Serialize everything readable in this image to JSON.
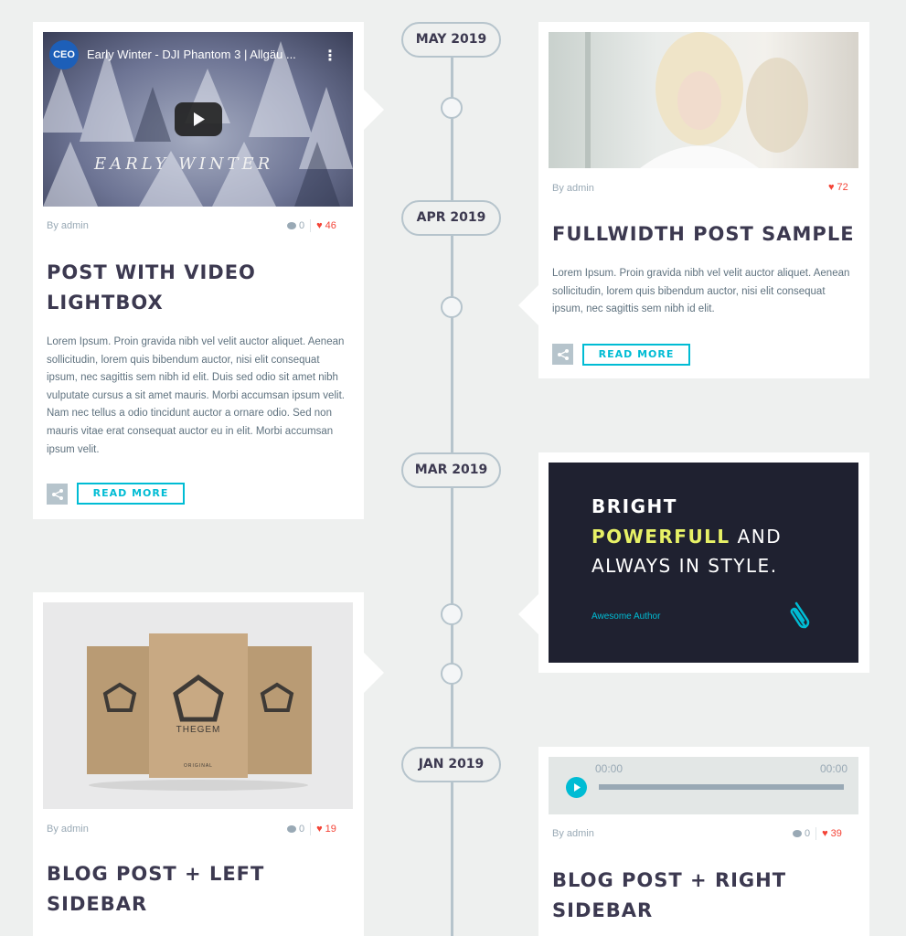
{
  "timeline": {
    "dates": [
      "MAY 2019",
      "APR 2019",
      "MAR 2019",
      "JAN 2019"
    ]
  },
  "posts": [
    {
      "author": "By admin",
      "comments": "0",
      "likes": "46",
      "title": "POST WITH VIDEO LIGHTBOX",
      "excerpt": "Lorem Ipsum. Proin gravida nibh vel velit auctor aliquet. Aenean sollicitudin, lorem quis bibendum auctor, nisi elit consequat ipsum, nec sagittis sem nibh id elit. Duis sed odio sit amet nibh vulputate cursus a sit amet mauris. Morbi accumsan ipsum velit. Nam nec tellus a odio tincidunt auctor a ornare odio. Sed non mauris vitae erat consequat auctor eu in elit. Morbi accumsan ipsum velit.",
      "read_more": "READ MORE",
      "video": {
        "channel_logo": "CEO",
        "title": "Early Winter - DJI Phantom 3 | Allgäu ...",
        "overlay_text": "EARLY WINTER"
      }
    },
    {
      "author": "By admin",
      "likes": "72",
      "title": "FULLWIDTH POST SAMPLE",
      "excerpt": "Lorem Ipsum. Proin gravida nibh vel velit auctor aliquet. Aenean sollicitudin, lorem quis bibendum auctor, nisi elit consequat ipsum, nec sagittis sem nibh id elit.",
      "read_more": "READ MORE"
    },
    {
      "quote_line1": "BRIGHT",
      "quote_highlight": "POWERFULL",
      "quote_line2_rest": " AND",
      "quote_line3": "ALWAYS IN STYLE.",
      "quote_author": "Awesome Author"
    },
    {
      "author": "By admin",
      "comments": "0",
      "likes": "19",
      "title": "BLOG POST + LEFT SIDEBAR",
      "brand": "THEGEM",
      "bag_label": "ORIGINAL"
    },
    {
      "author": "By admin",
      "comments": "0",
      "likes": "39",
      "title": "BLOG POST + RIGHT SIDEBAR",
      "audio": {
        "current_time": "00:00",
        "duration": "00:00"
      }
    }
  ],
  "colors": {
    "accent": "#00bcd4",
    "heart": "#f44336",
    "line": "#b6c4cc",
    "title": "#3c3950",
    "quote_bg": "#1f2130",
    "quote_highlight": "#e7f166"
  }
}
